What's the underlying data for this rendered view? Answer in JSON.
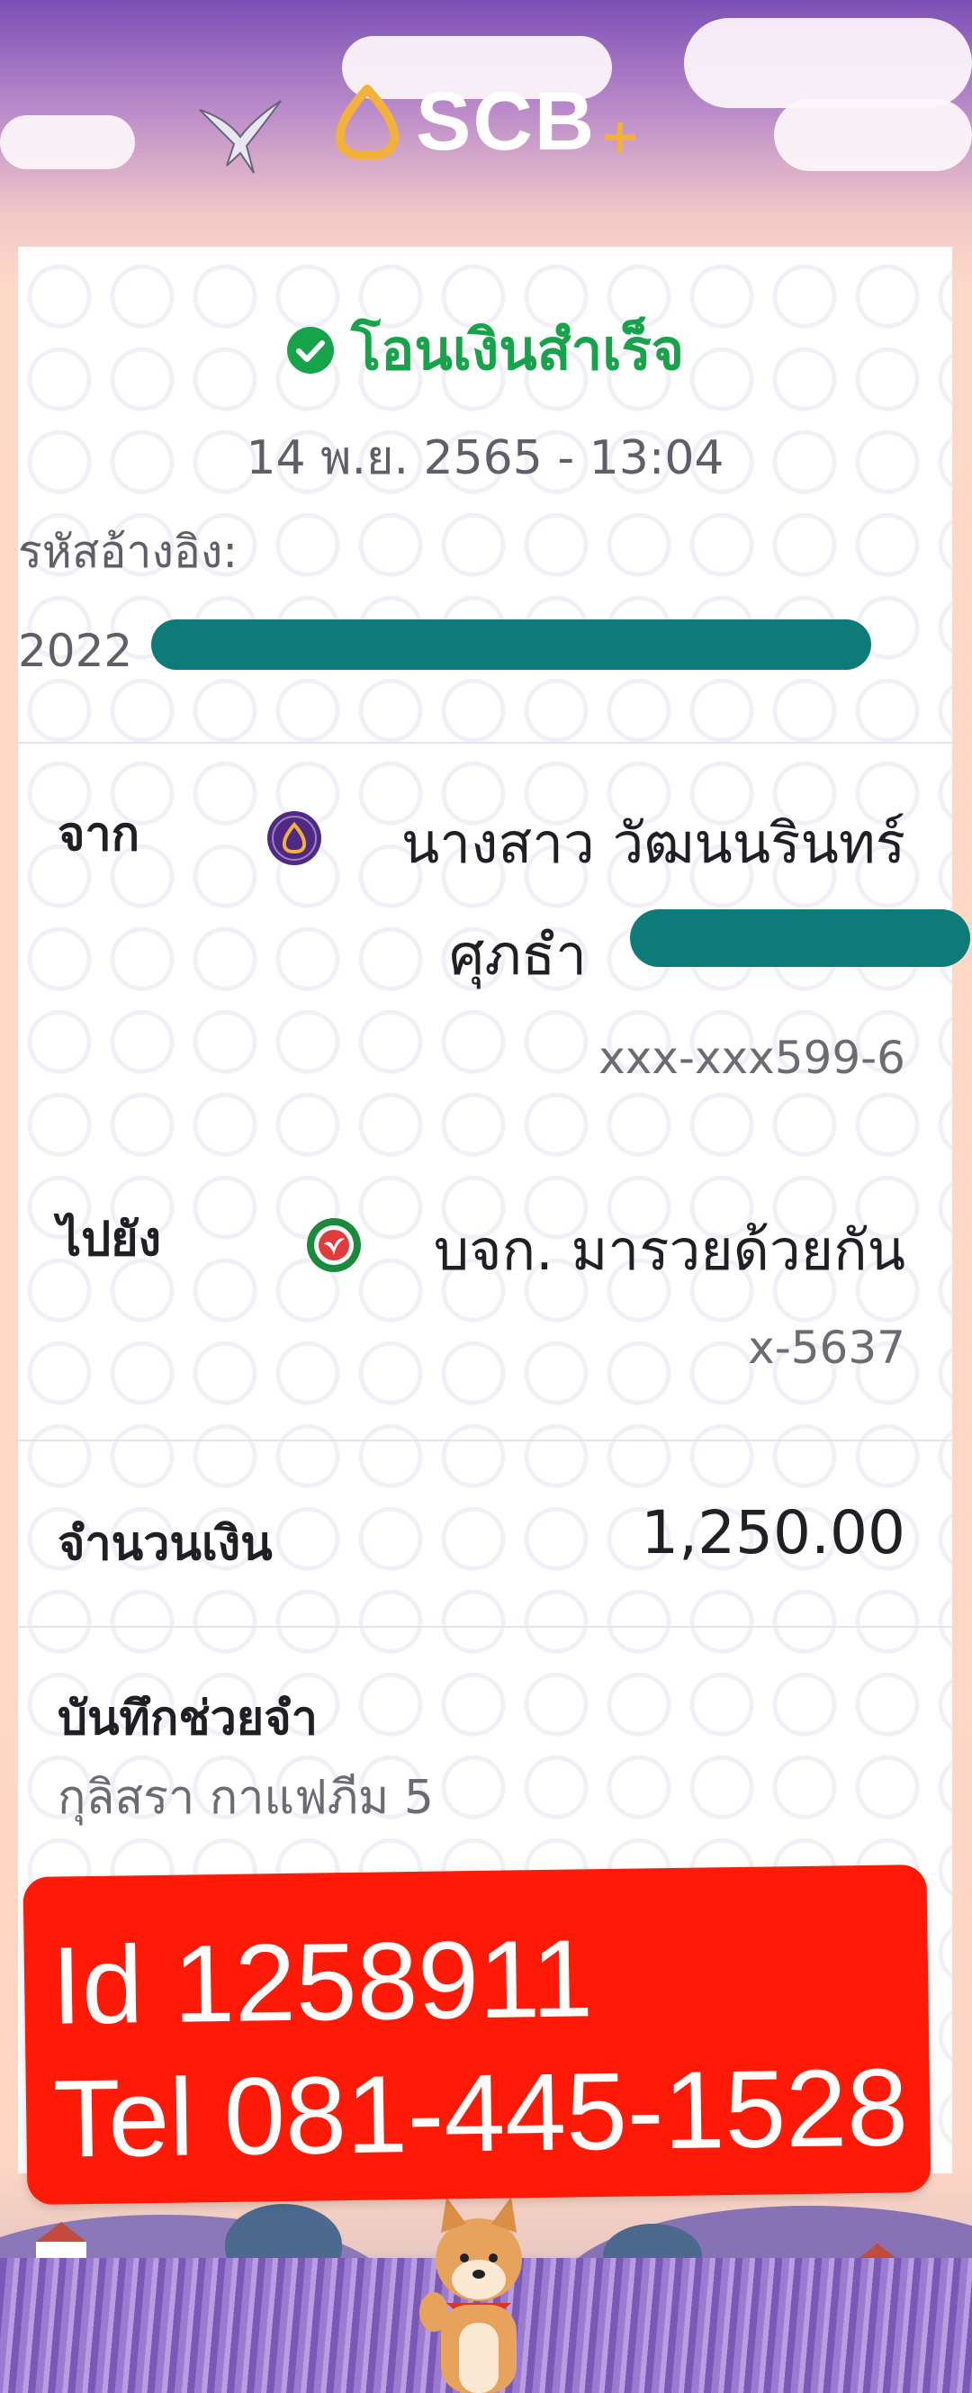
{
  "brand": {
    "name": "SCB",
    "plus": "+",
    "icon": "scb-logo-icon"
  },
  "receipt": {
    "status": "โอนเงินสำเร็จ",
    "status_icon": "check-circle-icon",
    "datetime": "14 พ.ย. 2565 - 13:04",
    "reference_label": "รหัสอ้างอิง:",
    "reference_value": "2022",
    "from": {
      "label": "จาก",
      "name_line1": "นางสาว วัฒนนรินทร์",
      "name_line2": "ศุภธำ",
      "account": "xxx-xxx599-6",
      "bank_icon": "scb-bank-icon"
    },
    "to": {
      "label": "ไปยัง",
      "name": "บจก. มารวยด้วยกัน",
      "account": "x-5637",
      "bank_icon": "kbank-bank-icon"
    },
    "amount_label": "จำนวนเงิน",
    "amount": "1,250.00",
    "memo_label": "บันทึกช่วยจำ",
    "memo": "กุลิสรา กาแฟภีม 5"
  },
  "overlay": {
    "line1": "Id 1258911",
    "line2": "Tel 081-445-1528"
  },
  "colors": {
    "success": "#16a34a",
    "mask": "#0f7b78",
    "overlay": "#ff1a08",
    "scb_purple": "#4e2a84",
    "kbank_green": "#1b8a3c"
  }
}
